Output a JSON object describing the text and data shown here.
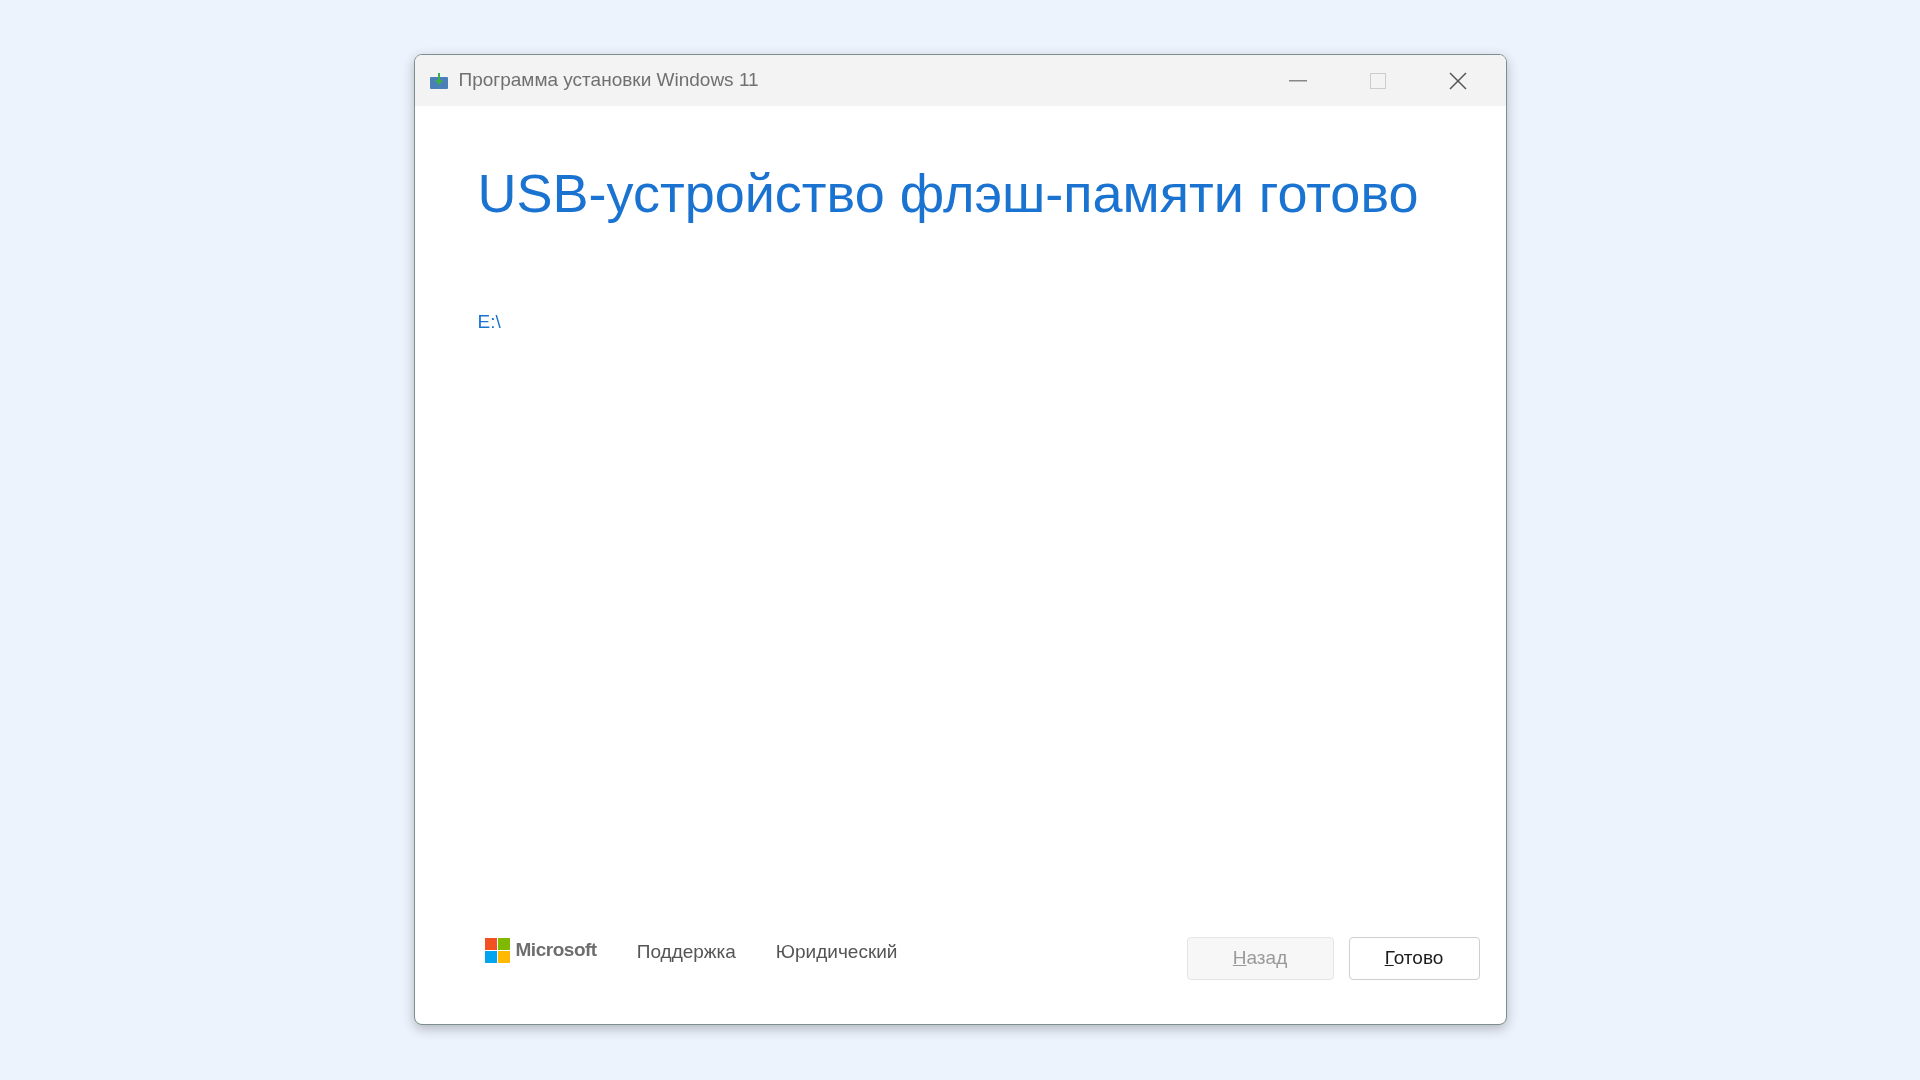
{
  "window": {
    "title": "Программа установки Windows 11"
  },
  "heading": "USB-устройство флэш-памяти готово",
  "drive": "E:\\",
  "footer": {
    "brand": "Microsoft",
    "links": [
      "Поддержка",
      "Юридический"
    ]
  },
  "buttons": [
    {
      "label": "Назад",
      "disabled": true
    },
    {
      "label": "Готово",
      "disabled": false
    }
  ]
}
